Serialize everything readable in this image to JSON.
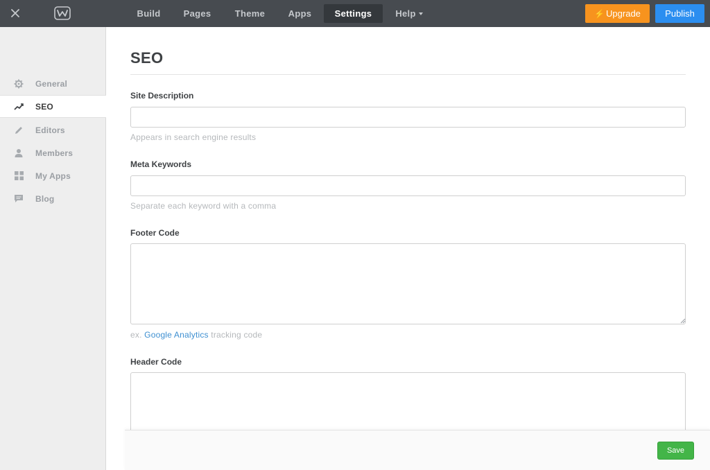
{
  "topbar": {
    "tabs": [
      {
        "label": "Build"
      },
      {
        "label": "Pages"
      },
      {
        "label": "Theme"
      },
      {
        "label": "Apps"
      },
      {
        "label": "Settings",
        "active": true
      },
      {
        "label": "Help"
      }
    ],
    "upgrade_label": "Upgrade",
    "publish_label": "Publish",
    "colors": {
      "bar": "#474b50",
      "upgrade": "#f7931e",
      "publish": "#2b8ef0"
    },
    "icons": {
      "close": "close-icon",
      "logo": "weebly-logo",
      "upgrade": "lightning-icon"
    }
  },
  "sidebar": {
    "items": [
      {
        "label": "General",
        "icon": "gear-icon"
      },
      {
        "label": "SEO",
        "icon": "trend-icon",
        "active": true
      },
      {
        "label": "Editors",
        "icon": "pencil-icon"
      },
      {
        "label": "Members",
        "icon": "person-icon"
      },
      {
        "label": "My Apps",
        "icon": "grid-icon"
      },
      {
        "label": "Blog",
        "icon": "chat-icon"
      }
    ]
  },
  "main": {
    "title": "SEO",
    "site_description": {
      "label": "Site Description",
      "value": "",
      "help": "Appears in search engine results"
    },
    "meta_keywords": {
      "label": "Meta Keywords",
      "value": "",
      "help": "Separate each keyword with a comma"
    },
    "footer_code": {
      "label": "Footer Code",
      "value": "",
      "help_prefix": "ex.",
      "help_link": "Google Analytics",
      "help_suffix": "tracking code"
    },
    "header_code": {
      "label": "Header Code",
      "value": ""
    }
  },
  "footer": {
    "save_label": "Save",
    "save_color": "#43b548"
  }
}
